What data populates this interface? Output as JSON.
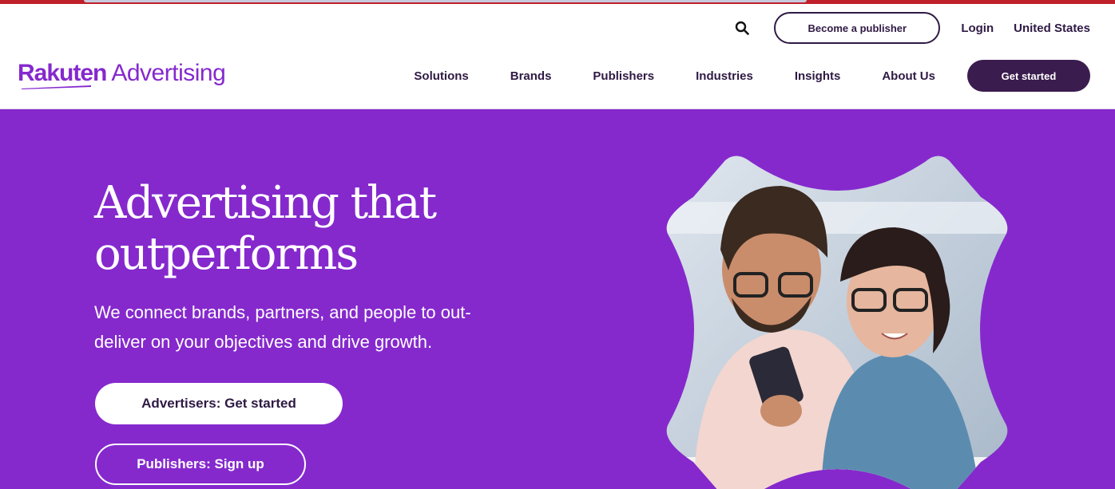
{
  "header": {
    "publisher_button": "Become a publisher",
    "login": "Login",
    "region": "United States",
    "get_started": "Get started"
  },
  "logo": {
    "brand": "Rakuten",
    "product": "Advertising"
  },
  "nav": {
    "items": [
      {
        "label": "Solutions"
      },
      {
        "label": "Brands"
      },
      {
        "label": "Publishers"
      },
      {
        "label": "Industries"
      },
      {
        "label": "Insights"
      },
      {
        "label": "About Us"
      }
    ]
  },
  "hero": {
    "title_line1": "Advertising that",
    "title_line2": "outperforms",
    "subtitle_line1": "We connect brands, partners, and people to out-",
    "subtitle_line2": "deliver on your objectives and drive growth.",
    "primary_cta": "Advertisers: Get started",
    "secondary_cta": "Publishers: Sign up"
  },
  "icons": {
    "search": "search-icon"
  },
  "colors": {
    "brand_purple": "#8529cd",
    "dark_purple": "#3b1c4e",
    "text_dark": "#2f1a44",
    "top_strip": "#c0202a"
  }
}
